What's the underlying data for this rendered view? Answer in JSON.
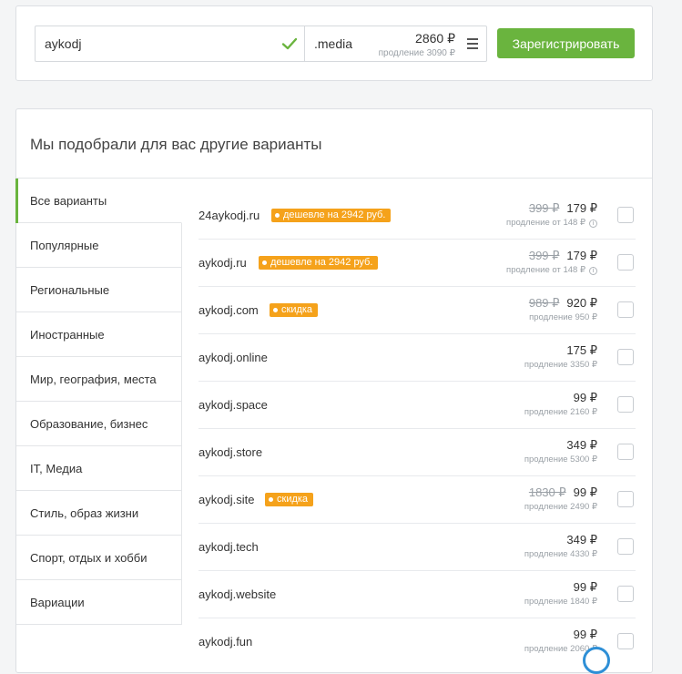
{
  "search": {
    "name_value": "aykodj",
    "zone": ".media",
    "price": "2860 ₽",
    "renew": "продление 3090 ₽",
    "register_label": "Зарегистрировать"
  },
  "main": {
    "title": "Мы подобрали для вас другие варианты"
  },
  "categories": [
    {
      "label": "Все варианты"
    },
    {
      "label": "Популярные"
    },
    {
      "label": "Региональные"
    },
    {
      "label": "Иностранные"
    },
    {
      "label": "Мир, география, места"
    },
    {
      "label": "Образование, бизнес"
    },
    {
      "label": "IT, Медиа"
    },
    {
      "label": "Стиль, образ жизни"
    },
    {
      "label": "Спорт, отдых и хобби"
    },
    {
      "label": "Вариации"
    }
  ],
  "domains": [
    {
      "name": "24aykodj.ru",
      "badge": "дешевле на 2942 руб.",
      "old_price": "399 ₽",
      "price": "179 ₽",
      "renew": "продление от 148 ₽",
      "info": "i"
    },
    {
      "name": "aykodj.ru",
      "badge": "дешевле на 2942 руб.",
      "old_price": "399 ₽",
      "price": "179 ₽",
      "renew": "продление от 148 ₽",
      "info": "i"
    },
    {
      "name": "aykodj.com",
      "badge": "скидка",
      "old_price": "989 ₽",
      "price": "920 ₽",
      "renew": "продление 950 ₽"
    },
    {
      "name": "aykodj.online",
      "price": "175 ₽",
      "renew": "продление 3350 ₽"
    },
    {
      "name": "aykodj.space",
      "price": "99 ₽",
      "renew": "продление 2160 ₽"
    },
    {
      "name": "aykodj.store",
      "price": "349 ₽",
      "renew": "продление 5300 ₽"
    },
    {
      "name": "aykodj.site",
      "badge": "скидка",
      "old_price": "1830 ₽",
      "price": "99 ₽",
      "renew": "продление 2490 ₽"
    },
    {
      "name": "aykodj.tech",
      "price": "349 ₽",
      "renew": "продление 4330 ₽"
    },
    {
      "name": "aykodj.website",
      "price": "99 ₽",
      "renew": "продление 1840 ₽"
    },
    {
      "name": "aykodj.fun",
      "price": "99 ₽",
      "renew": "продление 2060 ₽"
    }
  ],
  "colors": {
    "accent_green": "#6ab43e",
    "badge_orange": "#f5a21b",
    "scroll_blue": "#2e8fd6"
  }
}
